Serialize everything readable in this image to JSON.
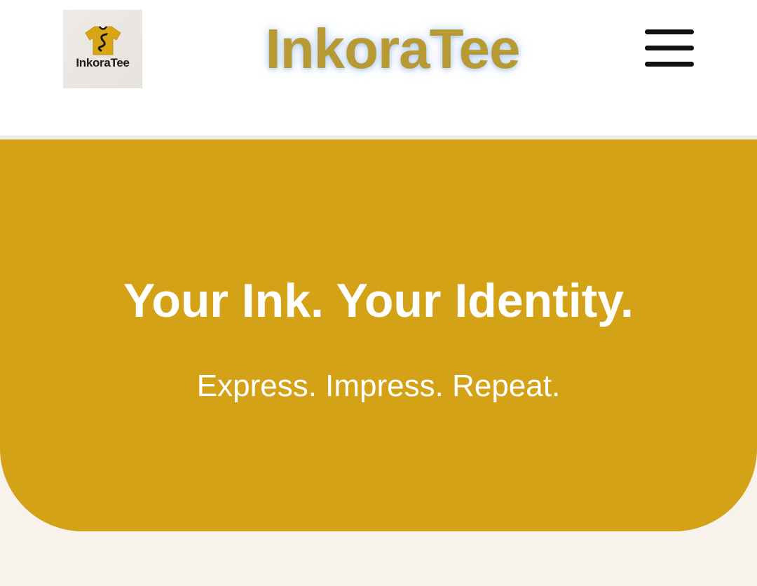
{
  "header": {
    "logo_text": "InkoraTee",
    "brand_title": "InkoraTee",
    "menu_icon": "hamburger-menu-icon"
  },
  "hero": {
    "title": "Your Ink. Your Identity.",
    "subtitle": "Express. Impress. Repeat."
  },
  "colors": {
    "brand_gold": "#b89a35",
    "hero_background": "#d4a216",
    "page_background": "#f7f3ec",
    "header_background": "#ffffff",
    "menu_icon": "#111111"
  }
}
